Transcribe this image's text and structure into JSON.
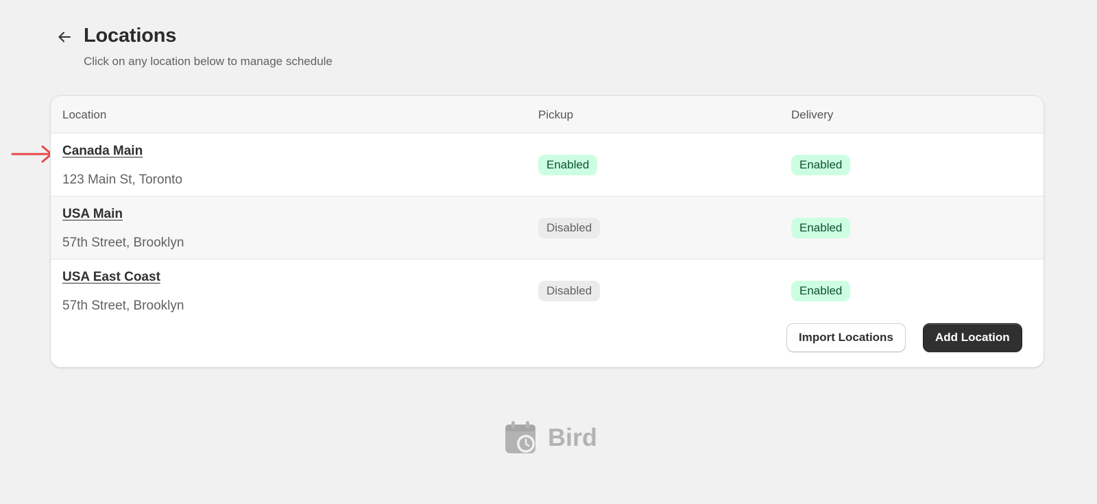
{
  "header": {
    "title": "Locations",
    "subtitle": "Click on any location below to manage schedule"
  },
  "table": {
    "columns": [
      "Location",
      "Pickup",
      "Delivery"
    ],
    "rows": [
      {
        "name": "Canada Main",
        "address": "123 Main St, Toronto",
        "pickup": "Enabled",
        "delivery": "Enabled"
      },
      {
        "name": "USA Main",
        "address": "57th Street, Brooklyn",
        "pickup": "Disabled",
        "delivery": "Enabled"
      },
      {
        "name": "USA East Coast",
        "address": "57th Street, Brooklyn",
        "pickup": "Disabled",
        "delivery": "Enabled"
      }
    ]
  },
  "actions": {
    "import_label": "Import Locations",
    "add_label": "Add Location"
  },
  "brand": {
    "name": "Bird",
    "icon": "calendar-clock-icon"
  },
  "colors": {
    "enabled_bg": "#cdfee1",
    "enabled_text": "#0c5132",
    "disabled_bg": "#ebebeb",
    "primary_button": "#303030",
    "annotation_arrow": "#e5484d"
  }
}
